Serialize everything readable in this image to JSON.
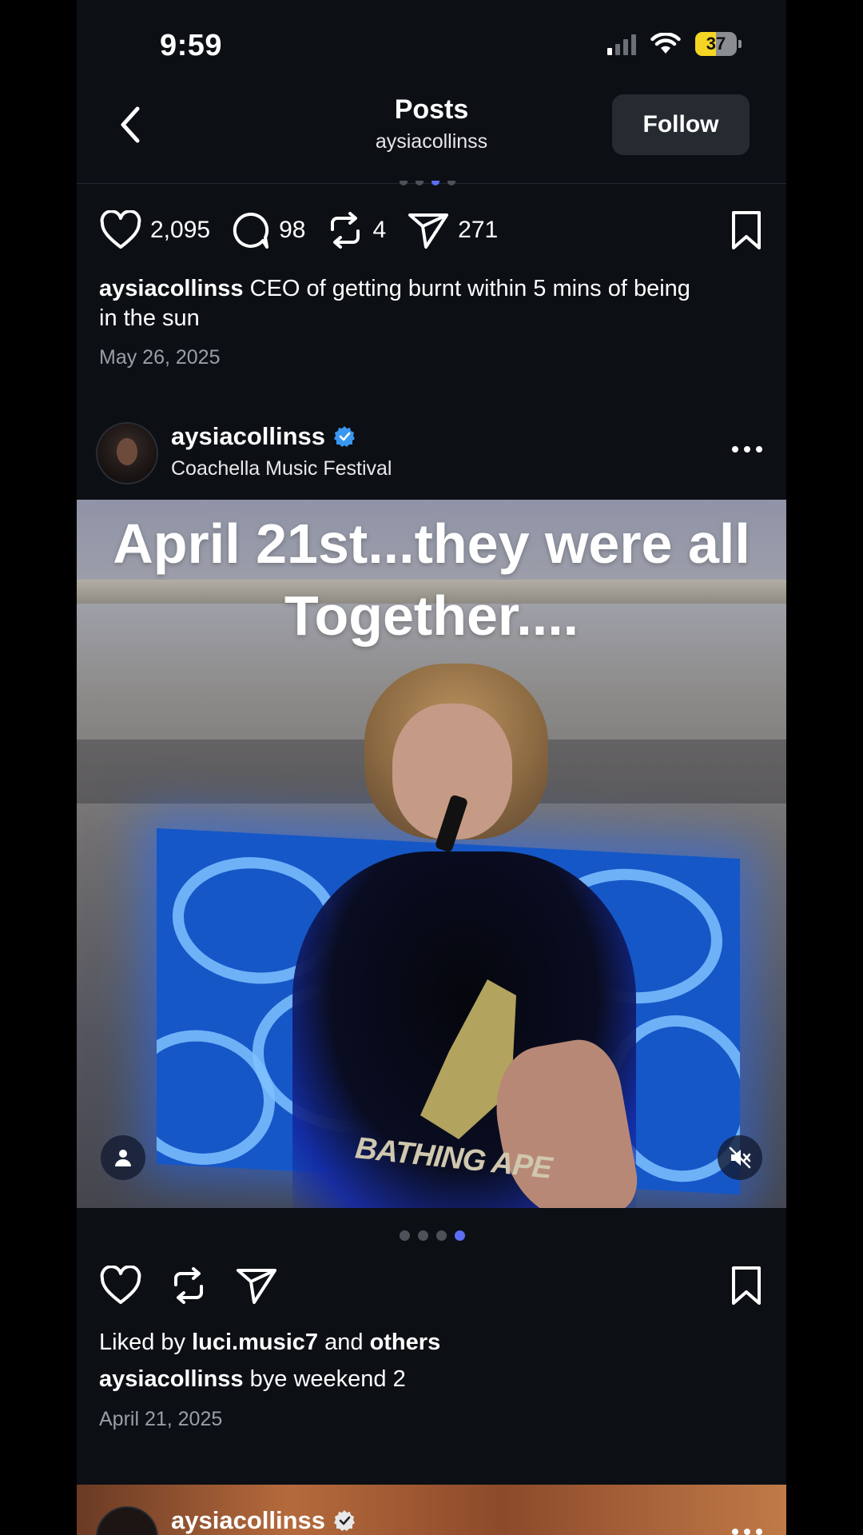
{
  "status": {
    "time": "9:59",
    "battery": "37"
  },
  "header": {
    "title": "Posts",
    "username": "aysiacollinss",
    "follow_label": "Follow"
  },
  "post1": {
    "likes": "2,095",
    "comments": "98",
    "reposts": "4",
    "shares": "271",
    "caption_user": "aysiacollinss",
    "caption_text": "CEO of getting burnt within 5 mins of being in the sun",
    "date": "May 26, 2025"
  },
  "post2": {
    "username": "aysiacollinss",
    "location": "Coachella Music Festival",
    "overlay_line1": "April 21st...they were all",
    "overlay_line2": "Together....",
    "shirt_text": "BATHING APE",
    "liked_by_prefix": "Liked by",
    "liked_by_user": "luci.music7",
    "liked_by_and": "and",
    "liked_by_others": "others",
    "caption_user": "aysiacollinss",
    "caption_text": "bye weekend 2",
    "date": "April 21, 2025",
    "carousel_total": 4,
    "carousel_active": 4
  },
  "post3": {
    "username": "aysiacollinss"
  },
  "icons": [
    "back-chevron-icon",
    "heart-icon",
    "comment-icon",
    "repost-icon",
    "send-icon",
    "bookmark-icon",
    "verified-icon",
    "more-icon",
    "person-tag-icon",
    "mute-icon",
    "wifi-icon",
    "signal-icon",
    "battery-icon"
  ],
  "colors": {
    "background": "#0c0f14",
    "accent": "#5b6ef5",
    "verified": "#3897f0",
    "follow_button": "#262a31"
  }
}
